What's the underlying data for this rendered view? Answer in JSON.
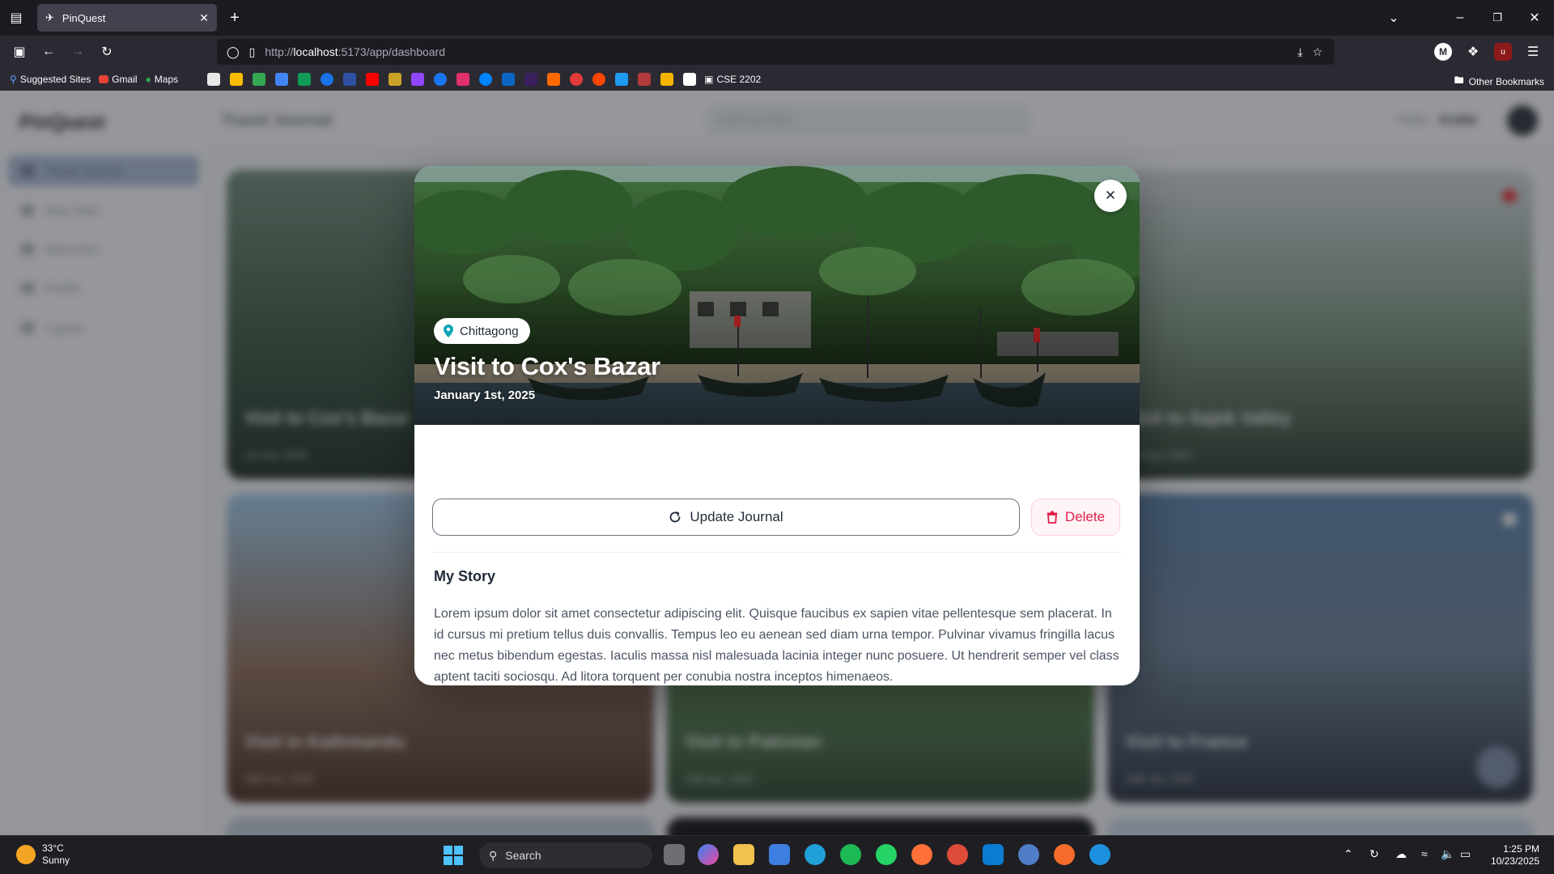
{
  "browser": {
    "tab_title": "PinQuest",
    "url_prefix": "http://",
    "url_host": "localhost",
    "url_rest": ":5173/app/dashboard",
    "bookmarks": [
      "Suggested Sites",
      "Gmail",
      "Maps"
    ],
    "bookmark_folder": "CSE 2202",
    "other_bookmarks": "Other Bookmarks"
  },
  "app": {
    "logo": "PinQuest",
    "page_title": "Travel Journal",
    "search_placeholder": "search journeys...",
    "greeting": "Hello,",
    "user_name": "Arafat",
    "nav": [
      "Travel Journal",
      "Map View",
      "Memories",
      "Profile",
      "Logout"
    ],
    "cards": [
      {
        "title": "Visit to Cox's Bazar",
        "date": "1st Jan, 2025"
      },
      {
        "title": "Visit to Sajek Valley",
        "date": "3rd Aug, 2024"
      },
      {
        "title": "Visit in Kathmandu",
        "date": "20th Oct, 2025"
      },
      {
        "title": "Visit to Pakistan",
        "date": "10th Apr, 2025"
      },
      {
        "title": "Visit to France",
        "date": "18th Jan, 2025"
      }
    ]
  },
  "modal": {
    "location": "Chittagong",
    "title": "Visit to Cox's Bazar",
    "date": "January 1st, 2025",
    "update_label": "Update Journal",
    "delete_label": "Delete",
    "story_heading": "My Story",
    "story_text": "Lorem ipsum dolor sit amet consectetur adipiscing elit. Quisque faucibus ex sapien vitae pellentesque sem placerat. In id cursus mi pretium tellus duis convallis. Tempus leo eu aenean sed diam urna tempor. Pulvinar vivamus fringilla lacus nec metus bibendum egestas. Iaculis massa nisl malesuada lacinia integer nunc posuere. Ut hendrerit semper vel class aptent taciti sociosqu. Ad litora torquent per conubia nostra inceptos himenaeos."
  },
  "taskbar": {
    "temperature": "33°C",
    "weather": "Sunny",
    "search": "Search",
    "time": "1:25 PM",
    "date": "10/23/2025"
  },
  "colors": {
    "accent_delete": "#e11d48",
    "location_pin": "#0ea5b7"
  }
}
